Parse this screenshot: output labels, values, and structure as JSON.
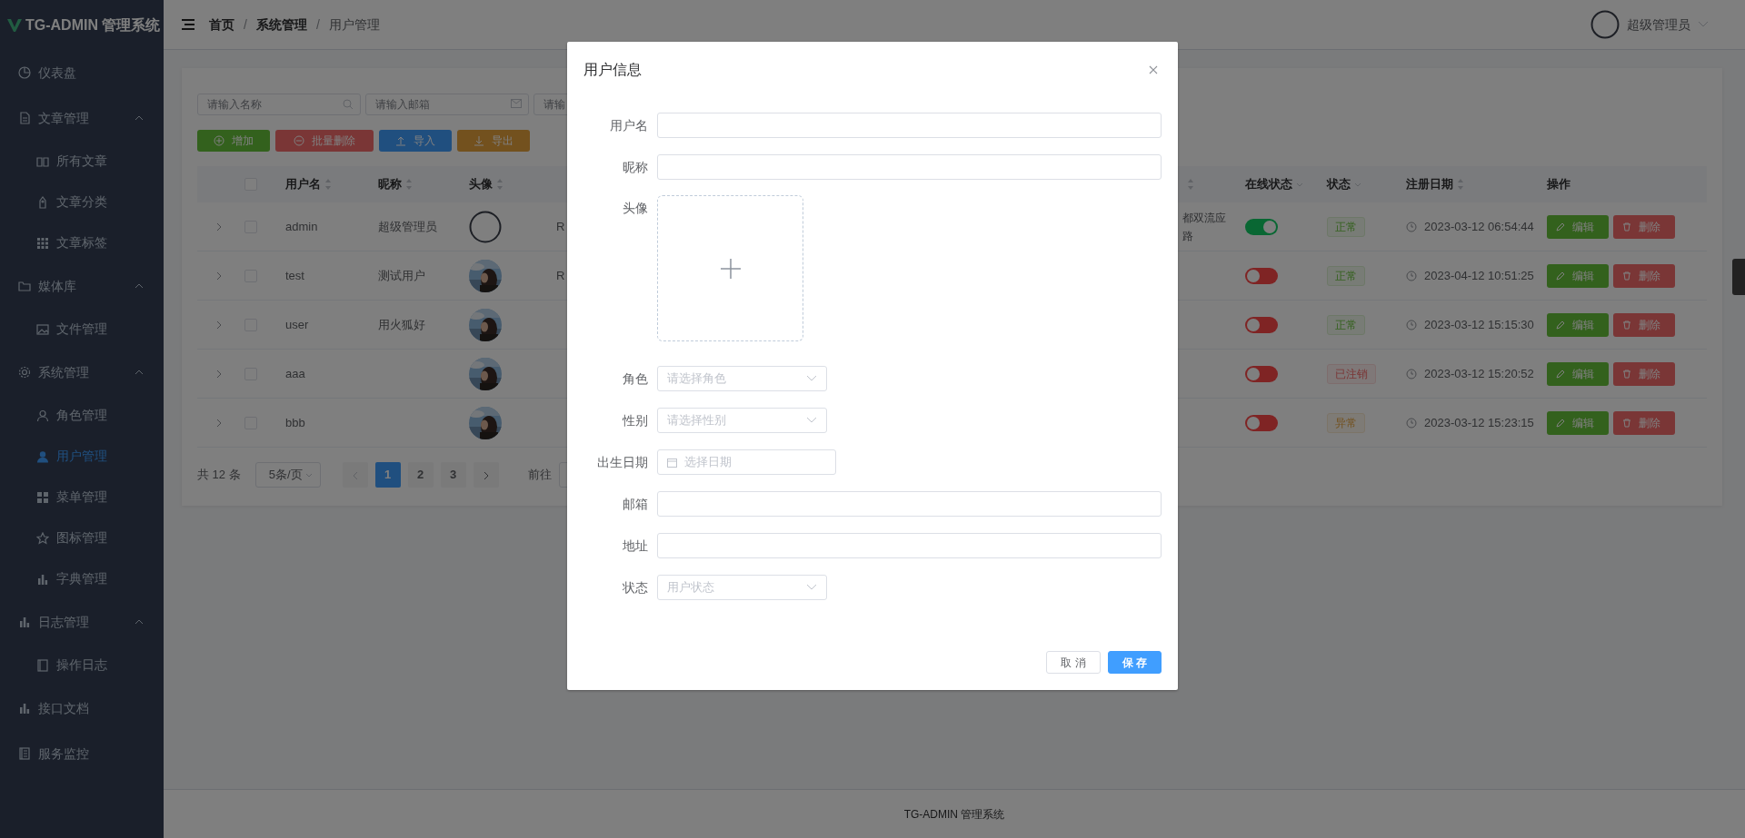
{
  "sidebar": {
    "title": "TG-ADMIN 管理系统",
    "items": [
      {
        "label": "仪表盘",
        "selected": false
      },
      {
        "label": "文章管理",
        "selected": false,
        "expanded": true,
        "children": [
          {
            "label": "所有文章",
            "selected": false
          },
          {
            "label": "文章分类",
            "selected": false
          },
          {
            "label": "文章标签",
            "selected": false
          }
        ]
      },
      {
        "label": "媒体库",
        "selected": false,
        "expanded": true,
        "children": [
          {
            "label": "文件管理",
            "selected": false
          }
        ]
      },
      {
        "label": "系统管理",
        "selected": false,
        "expanded": true,
        "children": [
          {
            "label": "角色管理",
            "selected": false
          },
          {
            "label": "用户管理",
            "selected": true
          },
          {
            "label": "菜单管理",
            "selected": false
          },
          {
            "label": "图标管理",
            "selected": false
          },
          {
            "label": "字典管理",
            "selected": false
          }
        ]
      },
      {
        "label": "日志管理",
        "selected": false,
        "expanded": true,
        "children": [
          {
            "label": "操作日志",
            "selected": false
          }
        ]
      },
      {
        "label": "接口文档",
        "selected": false
      },
      {
        "label": "服务监控",
        "selected": false
      }
    ]
  },
  "header": {
    "breadcrumb": [
      {
        "label": "首页"
      },
      {
        "separator": "/",
        "label": "系统管理"
      },
      {
        "separator": "/",
        "label": "用户管理"
      }
    ],
    "user": "超级管理员"
  },
  "search": [
    {
      "placeholder": "请输入名称"
    },
    {
      "placeholder": "请输入邮箱"
    },
    {
      "placeholder": "请输"
    }
  ],
  "toolbar": [
    {
      "label": "增加",
      "kind": "add"
    },
    {
      "label": "批量删除",
      "kind": "remove"
    },
    {
      "label": "导入",
      "kind": "import"
    },
    {
      "label": "导出",
      "kind": "export"
    }
  ],
  "table": {
    "all_checked": false,
    "columns": [
      {
        "label": "用户名",
        "kind": "sort"
      },
      {
        "label": "昵称",
        "kind": "sort"
      },
      {
        "label": "头像",
        "kind": "sort"
      },
      {
        "kind": "sort"
      },
      {
        "label": "在线状态",
        "kind": "filter"
      },
      {
        "label": "状态",
        "kind": "filter"
      },
      {
        "label": "注册日期",
        "kind": "sort"
      },
      {
        "label": "操作",
        "kind": "plain"
      }
    ],
    "rows": [
      {
        "checked": false,
        "username": "admin",
        "nickname": "超级管理员",
        "avatar": {
          "kind": "icon"
        },
        "column_6": "R",
        "column_7": [
          "都双流应",
          "路"
        ],
        "online": true,
        "status": {
          "text": "正常",
          "color": "#34611d"
        },
        "registered": "2023-03-12 06:54:44",
        "edit": "编辑",
        "delete": "删除"
      },
      {
        "checked": false,
        "username": "test",
        "nickname": "测试用户",
        "column_6": "R",
        "online": false,
        "status": {
          "text": "正常",
          "color": "#34611d"
        },
        "registered": "2023-04-12 10:51:25",
        "edit": "编辑",
        "delete": "删除"
      },
      {
        "checked": false,
        "username": "user",
        "nickname": "用火狐好",
        "online": false,
        "status": {
          "text": "正常",
          "color": "#34611d"
        },
        "registered": "2023-03-12 15:15:30",
        "edit": "编辑",
        "delete": "删除"
      },
      {
        "checked": false,
        "username": "aaa",
        "online": false,
        "status": {
          "text": "已注销",
          "color": "#7b3636"
        },
        "registered": "2023-03-12 15:20:52",
        "edit": "编辑",
        "delete": "删除"
      },
      {
        "checked": false,
        "username": "bbb",
        "online": false,
        "status": {
          "text": "异常",
          "color": "#73511e"
        },
        "registered": "2023-03-12 15:23:15",
        "edit": "编辑",
        "delete": "删除"
      }
    ]
  },
  "pagination": {
    "total": "共 12 条",
    "page_size": "5条/页",
    "pages": [
      {
        "label": "1",
        "selected": true
      },
      {
        "label": "2",
        "selected": false
      },
      {
        "label": "3",
        "selected": false
      }
    ],
    "goto": "前往"
  },
  "modal": {
    "title": "用户信息",
    "fields": [
      {
        "label": "用户名",
        "kind": "text"
      },
      {
        "label": "昵称",
        "kind": "text"
      },
      {
        "label": "头像",
        "kind": "upload"
      },
      {
        "label": "角色",
        "kind": "select",
        "placeholder": "请选择角色"
      },
      {
        "label": "性别",
        "kind": "select",
        "placeholder": "请选择性别"
      },
      {
        "label": "出生日期",
        "kind": "date",
        "placeholder": "选择日期"
      },
      {
        "label": "邮箱",
        "kind": "text"
      },
      {
        "label": "地址",
        "kind": "text"
      },
      {
        "label": "状态",
        "kind": "select",
        "placeholder": "用户状态"
      }
    ],
    "buttons": [
      {
        "label": "取 消",
        "kind": "secondary"
      },
      {
        "label": "保 存",
        "kind": "primary"
      }
    ]
  },
  "footer": "TG-ADMIN 管理系统"
}
